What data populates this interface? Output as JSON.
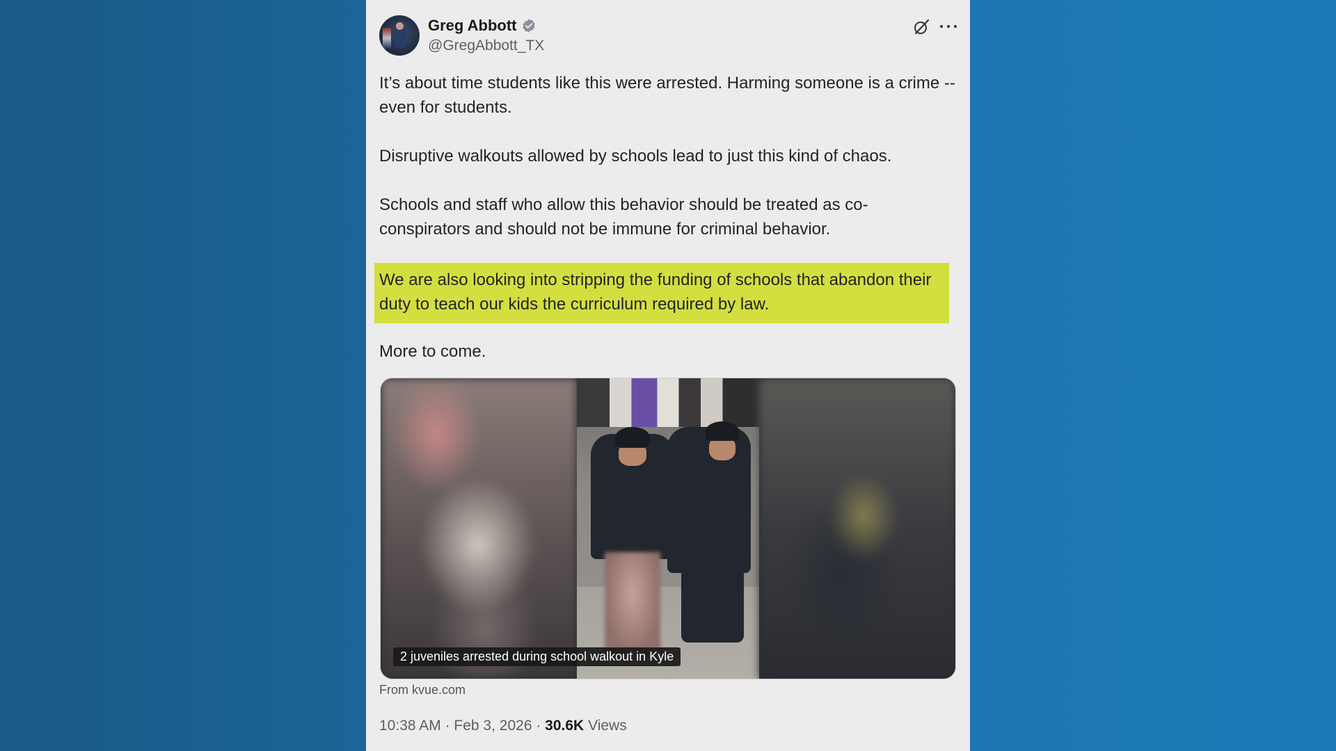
{
  "post": {
    "author": {
      "display_name": "Greg Abbott",
      "handle": "@GregAbbott_TX",
      "verified": true
    },
    "paragraphs": [
      "It’s about time students like this were arrested. Harming someone is a crime -- even for students.",
      "Disruptive walkouts allowed by schools lead to just this kind of chaos.",
      "Schools and staff who allow this behavior should be treated as co-conspirators and should not be immune for criminal behavior.",
      "We are also looking into stripping the funding of schools that abandon their duty to teach our kids the curriculum required by law.",
      "More to come."
    ],
    "highlighted_paragraph_color": "#d3df3f",
    "media": {
      "caption": "2 juveniles arrested during school walkout in Kyle",
      "source": "From kvue.com"
    },
    "meta": {
      "time": "10:38 AM",
      "separator": " · ",
      "date": "Feb 3, 2026",
      "views_count": "30.6K",
      "views_label": "Views"
    },
    "icons": [
      "verified-badge-icon",
      "grok-icon",
      "more-options-icon"
    ]
  },
  "colors": {
    "background": "#1b6ba0",
    "card": "#ececec",
    "verified_badge": "#8a9199"
  }
}
